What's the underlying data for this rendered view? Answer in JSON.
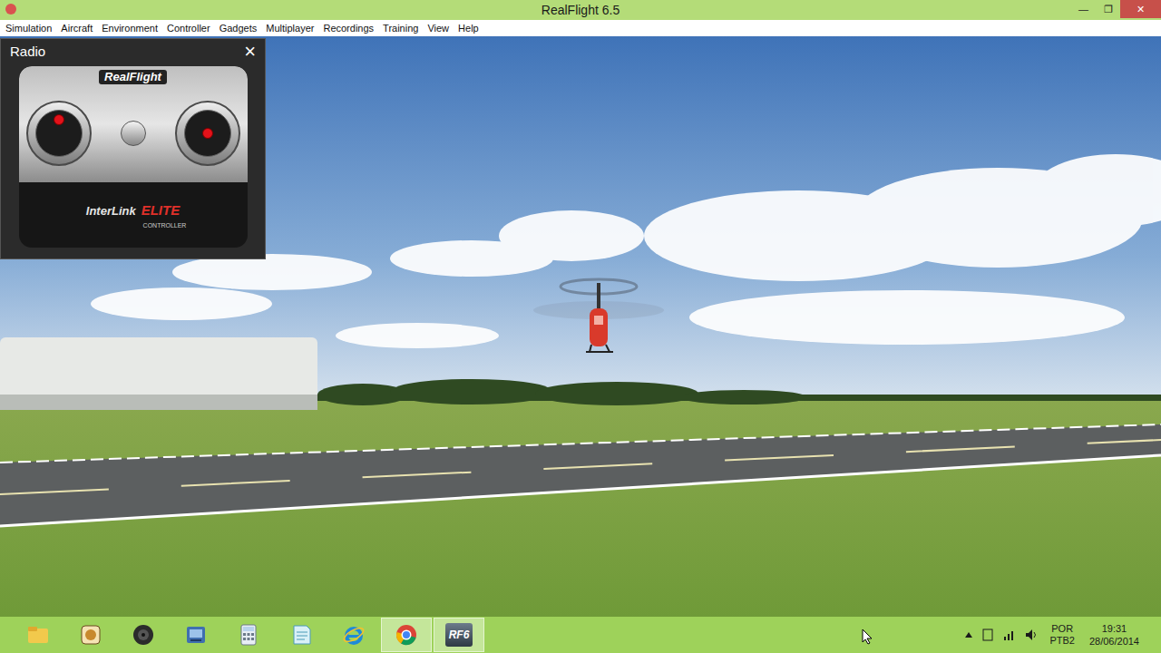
{
  "window": {
    "title": "RealFlight 6.5",
    "controls": [
      "—",
      "❐",
      "✕"
    ]
  },
  "menu": [
    "Simulation",
    "Aircraft",
    "Environment",
    "Controller",
    "Gadgets",
    "Multiplayer",
    "Recordings",
    "Training",
    "View",
    "Help"
  ],
  "radio_panel": {
    "title": "Radio",
    "close": "×",
    "brand": "RealFlight",
    "model": "InterLink",
    "model_suffix": "ELITE",
    "model_sub": "CONTROLLER",
    "sticks": [
      {
        "name": "left",
        "x": 0.5,
        "y": 0.2
      },
      {
        "name": "right",
        "x": 0.5,
        "y": 0.5
      }
    ]
  },
  "taskbar": {
    "apps": [
      {
        "kind": "folder",
        "selected": false
      },
      {
        "kind": "app",
        "selected": false
      },
      {
        "kind": "media",
        "selected": false
      },
      {
        "kind": "game",
        "selected": false
      },
      {
        "kind": "calculator",
        "selected": false
      },
      {
        "kind": "notes",
        "selected": false
      },
      {
        "kind": "ie",
        "selected": false
      },
      {
        "kind": "chrome",
        "selected": true
      },
      {
        "kind": "realflight",
        "label": "RF6",
        "selected": true
      }
    ],
    "tray": {
      "language": "POR",
      "layout": "PTB2",
      "time": "19:31",
      "date": "28/06/2014"
    }
  }
}
